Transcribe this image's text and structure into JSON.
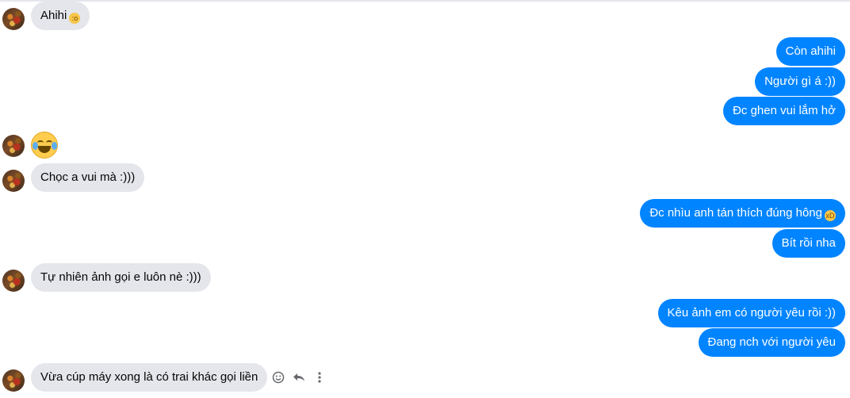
{
  "messages": [
    {
      "side": "in",
      "text": "Ahihi",
      "emoji": "😳"
    },
    {
      "side": "out",
      "text": "Còn ahihi"
    },
    {
      "side": "out",
      "text": "Người gì á :))"
    },
    {
      "side": "out",
      "text": "Đc ghen vui lắm hở"
    },
    {
      "side": "in",
      "emoji_only": "laughing-tears-emoji"
    },
    {
      "side": "in",
      "text": "Chọc a vui mà :)))"
    },
    {
      "side": "out",
      "text": "Đc nhìu anh tán thích đúng hông",
      "emoji": "😆"
    },
    {
      "side": "out",
      "text": "Bít rồi nha"
    },
    {
      "side": "in",
      "text": "Tự nhiên ảnh gọi e luôn nè :)))"
    },
    {
      "side": "out",
      "text": "Kêu ảnh em có người yêu rồi :))"
    },
    {
      "side": "out",
      "text": "Đang nch với người yêu"
    },
    {
      "side": "in",
      "text": "Vừa cúp máy xong là có trai khác gọi liền"
    }
  ],
  "hover_actions": [
    "react-icon",
    "reply-icon",
    "more-icon"
  ],
  "colors": {
    "outgoing": "#0084ff",
    "incoming": "#e4e6eb"
  }
}
